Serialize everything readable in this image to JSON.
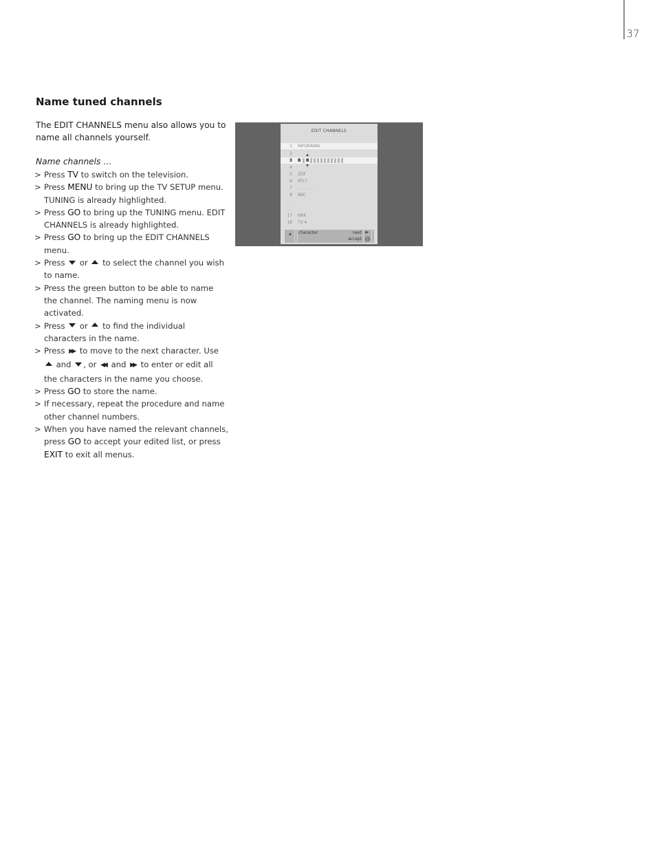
{
  "page": {
    "number": "37"
  },
  "section": {
    "title": "Name tuned channels",
    "intro": "The EDIT CHANNELS menu also allows you to name all channels yourself.",
    "subhead": "Name channels …"
  },
  "steps": [
    {
      "parts": [
        {
          "t": "Press "
        },
        {
          "k": "TV"
        },
        {
          "t": " to switch on the television."
        }
      ]
    },
    {
      "parts": [
        {
          "t": "Press "
        },
        {
          "k": "MENU"
        },
        {
          "t": " to bring up the TV SETUP menu. TUNING is already highlighted."
        }
      ]
    },
    {
      "parts": [
        {
          "t": "Press "
        },
        {
          "k": "GO"
        },
        {
          "t": " to bring up the TUNING menu. EDIT CHANNELS is already highlighted."
        }
      ]
    },
    {
      "parts": [
        {
          "t": "Press "
        },
        {
          "k": "GO"
        },
        {
          "t": " to bring up the EDIT CHANNELS menu."
        }
      ]
    },
    {
      "parts": [
        {
          "t": "Press "
        },
        {
          "i": "down-arrow-icon"
        },
        {
          "t": " or "
        },
        {
          "i": "up-arrow-icon"
        },
        {
          "t": " to select the channel you wish to name."
        }
      ]
    },
    {
      "parts": [
        {
          "t": "Press the green button to be able to name the channel. The naming menu is now activated."
        }
      ]
    },
    {
      "parts": [
        {
          "t": "Press "
        },
        {
          "i": "down-arrow-icon"
        },
        {
          "t": " or "
        },
        {
          "i": "up-arrow-icon"
        },
        {
          "t": " to find the individual characters in the name."
        }
      ]
    },
    {
      "parts": [
        {
          "t": "Press "
        },
        {
          "i": "fast-forward-icon"
        },
        {
          "t": " to move to the next character. Use "
        },
        {
          "i": "up-arrow-icon"
        },
        {
          "t": " and "
        },
        {
          "i": "down-arrow-icon"
        },
        {
          "t": ", or "
        },
        {
          "i": "rewind-icon"
        },
        {
          "t": " and "
        },
        {
          "i": "fast-forward-icon"
        },
        {
          "t": " to enter or edit all the characters in the name you choose."
        }
      ]
    },
    {
      "parts": [
        {
          "t": "Press "
        },
        {
          "k": "GO"
        },
        {
          "t": " to store the name."
        }
      ]
    },
    {
      "parts": [
        {
          "t": "If necessary, repeat the procedure and name other channel numbers."
        }
      ]
    },
    {
      "parts": [
        {
          "t": "When you have named the relevant channels, press "
        },
        {
          "k": "GO"
        },
        {
          "t": " to accept your edited list, or press "
        },
        {
          "k": "EXIT"
        },
        {
          "t": " to exit all menus."
        }
      ]
    }
  ],
  "step_marker": ">",
  "tv_menu": {
    "title": "EDIT  CHANNELS",
    "channels": [
      {
        "num": "1",
        "name": "INFOKANAL",
        "highlight": true
      },
      {
        "num": "2",
        "name": ""
      },
      {
        "num": "3",
        "name": "B",
        "active": true,
        "editing_char": "B"
      },
      {
        "num": "4",
        "name": ""
      },
      {
        "num": "5",
        "name": "ZDF"
      },
      {
        "num": "6",
        "name": "RTL7"
      },
      {
        "num": "7",
        "name": ". . . . . . . ."
      },
      {
        "num": "8",
        "name": "BBC"
      },
      {
        "num": "17",
        "name": "NRK"
      },
      {
        "num": "18",
        "name": "TV 4"
      }
    ],
    "ellipsis": ". .",
    "footer": {
      "left_icon": "up-arrow-icon",
      "character_label": "character",
      "next_label": "next",
      "accept_label": "accept",
      "next_icon": "fast-forward-icon",
      "accept_icon": "go-icon"
    }
  },
  "colors": {
    "tv_background": "#646363",
    "menu_background": "#dcdcdc",
    "menu_highlight": "#f2f2f2",
    "menu_bar": "#b3b3b3"
  }
}
